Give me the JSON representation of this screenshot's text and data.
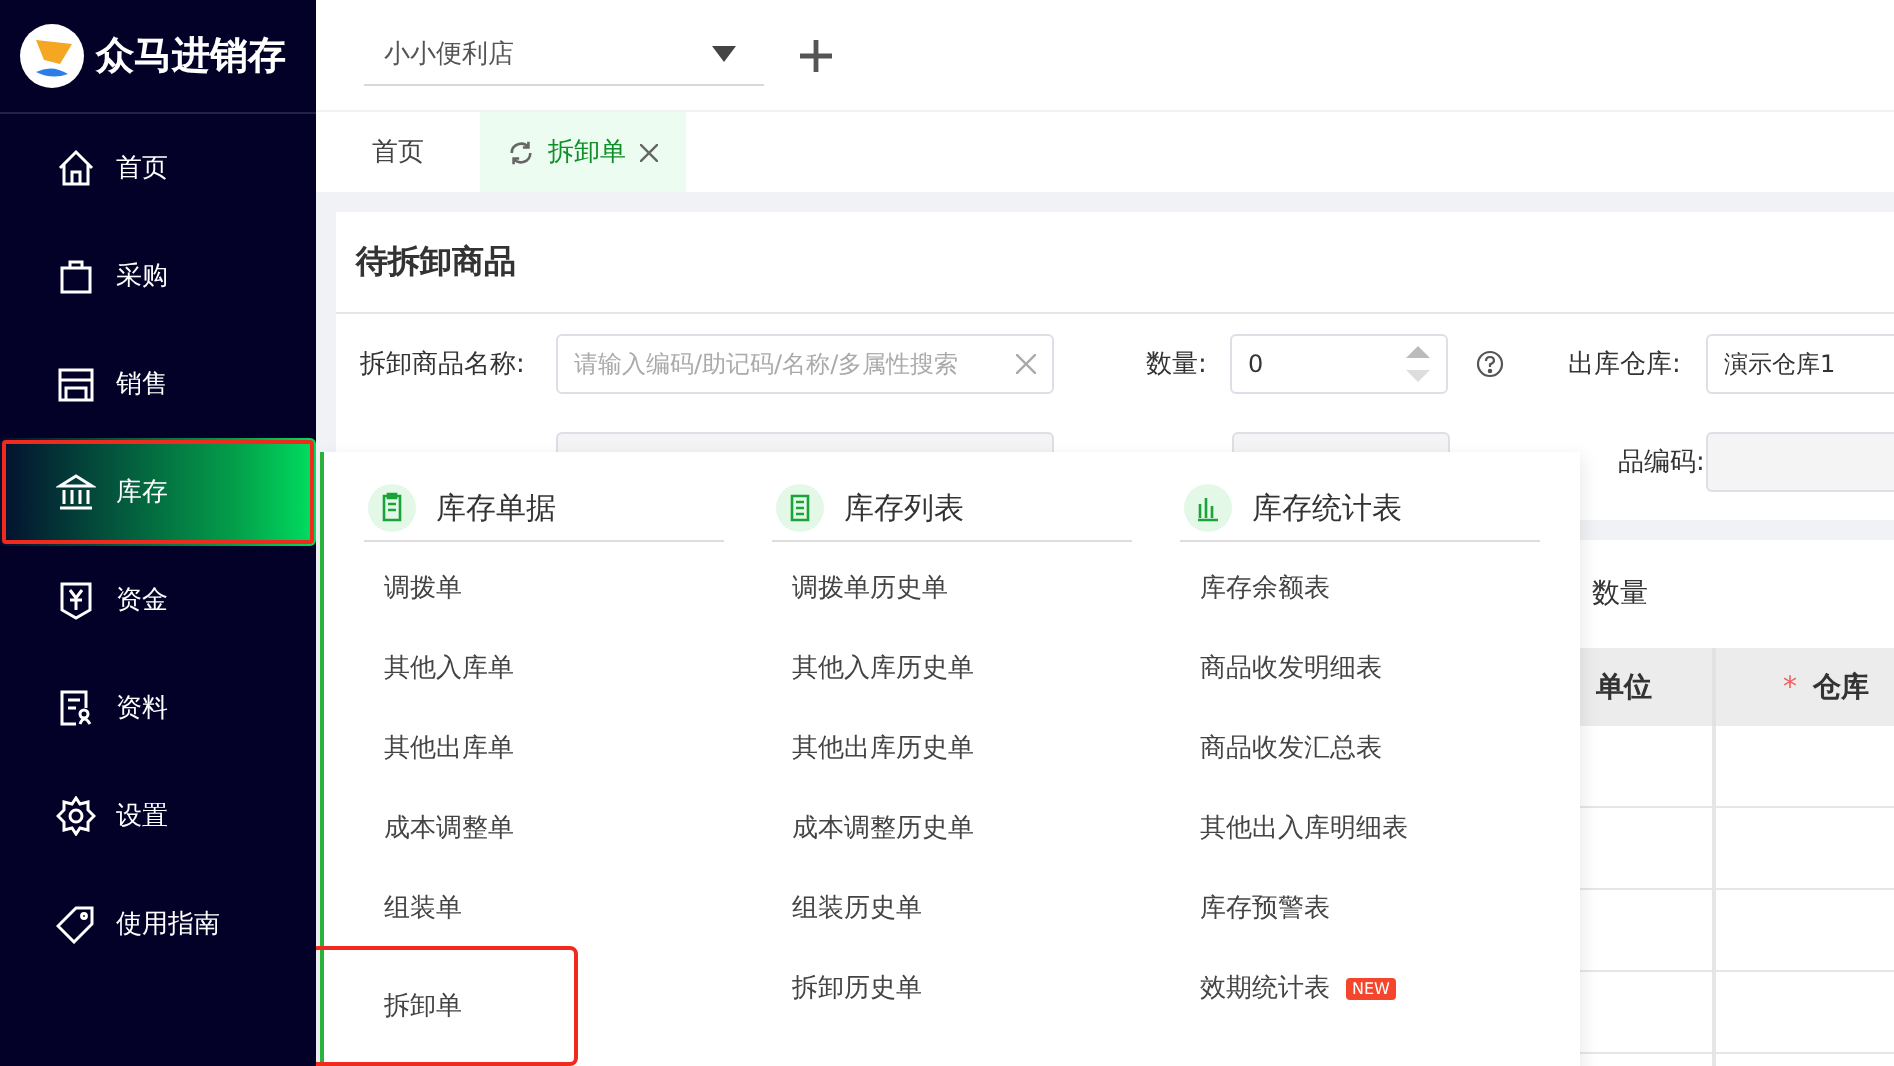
{
  "app": {
    "name": "众马进销存"
  },
  "sidebar": {
    "items": [
      {
        "label": "首页",
        "selected": false,
        "annotated": false
      },
      {
        "label": "采购",
        "selected": false,
        "annotated": false
      },
      {
        "label": "销售",
        "selected": false,
        "annotated": false
      },
      {
        "label": "库存",
        "selected": true,
        "annotated": true
      },
      {
        "label": "资金",
        "selected": false,
        "annotated": false
      },
      {
        "label": "资料",
        "selected": false,
        "annotated": false
      },
      {
        "label": "设置",
        "selected": false,
        "annotated": false
      },
      {
        "label": "使用指南",
        "selected": false,
        "annotated": false
      }
    ]
  },
  "store_select": {
    "value": "小小便利店"
  },
  "tabs": [
    {
      "label": "首页",
      "selected": false
    },
    {
      "label": "拆卸单",
      "selected": true
    }
  ],
  "panel": {
    "title": "待拆卸商品",
    "fields": [
      {
        "label": "拆卸商品名称:",
        "placeholder": "请输入编码/助记码/名称/多属性搜索",
        "kind": "search"
      },
      {
        "label": "数量:",
        "value": "0",
        "kind": "number"
      },
      {
        "label": "出库仓库:",
        "value": "演示仓库1",
        "kind": "select"
      }
    ],
    "row2_label": "品编码:"
  },
  "detail": {
    "label": "数量",
    "columns": [
      {
        "label": "单位"
      },
      {
        "label": "仓库",
        "required_mark": "*"
      }
    ]
  },
  "menu": {
    "groups": [
      {
        "title": "库存单据",
        "items": [
          {
            "label": "调拨单",
            "annotated": false
          },
          {
            "label": "其他入库单",
            "annotated": false
          },
          {
            "label": "其他出库单",
            "annotated": false
          },
          {
            "label": "成本调整单",
            "annotated": false
          },
          {
            "label": "组装单",
            "annotated": false
          },
          {
            "label": "拆卸单",
            "annotated": true
          }
        ]
      },
      {
        "title": "库存列表",
        "items": [
          {
            "label": "调拨单历史单",
            "annotated": false
          },
          {
            "label": "其他入库历史单",
            "annotated": false
          },
          {
            "label": "其他出库历史单",
            "annotated": false
          },
          {
            "label": "成本调整历史单",
            "annotated": false
          },
          {
            "label": "组装历史单",
            "annotated": false
          },
          {
            "label": "拆卸历史单",
            "annotated": false
          }
        ]
      },
      {
        "title": "库存统计表",
        "items": [
          {
            "label": "库存余额表",
            "annotated": false
          },
          {
            "label": "商品收发明细表",
            "annotated": false
          },
          {
            "label": "商品收发汇总表",
            "annotated": false
          },
          {
            "label": "其他出入库明细表",
            "annotated": false
          },
          {
            "label": "库存预警表",
            "annotated": false
          },
          {
            "label": "效期统计表",
            "annotated": false,
            "badge": "NEW"
          }
        ]
      }
    ]
  }
}
